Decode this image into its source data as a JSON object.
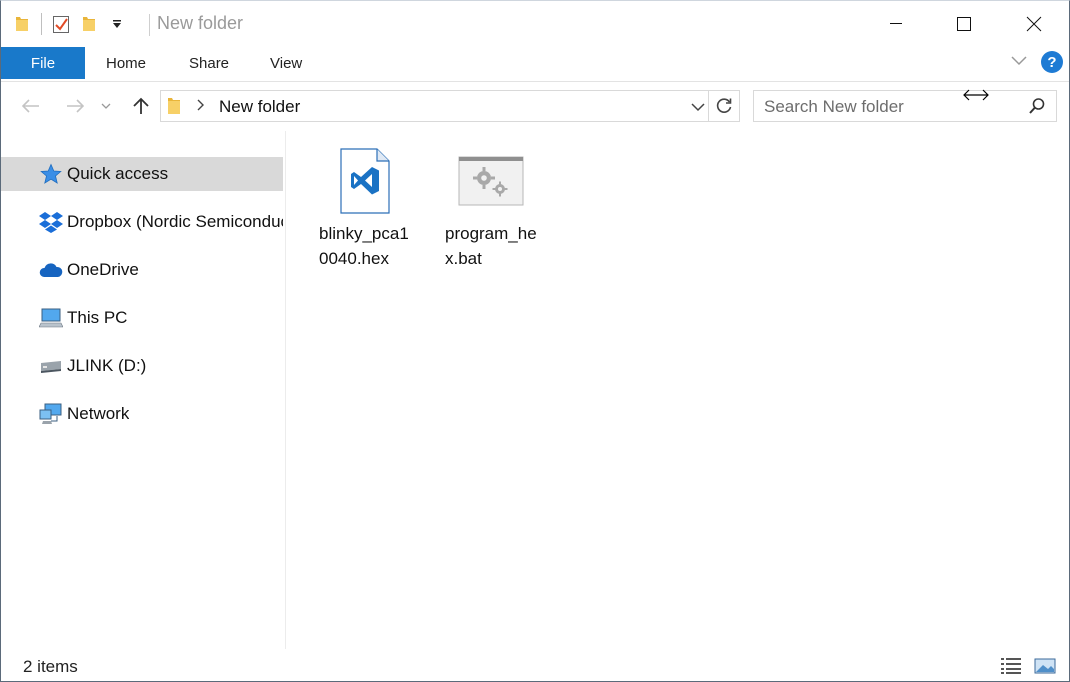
{
  "window": {
    "title": "New folder"
  },
  "ribbon": {
    "tabs": [
      {
        "label": "File"
      },
      {
        "label": "Home"
      },
      {
        "label": "Share"
      },
      {
        "label": "View"
      }
    ]
  },
  "address": {
    "path": "New folder"
  },
  "search": {
    "placeholder": "Search New folder"
  },
  "nav": {
    "items": [
      {
        "label": "Quick access",
        "icon": "star-icon",
        "selected": true
      },
      {
        "label": "Dropbox (Nordic Semiconductor ASA)",
        "icon": "dropbox-icon"
      },
      {
        "label": "OneDrive",
        "icon": "cloud-icon"
      },
      {
        "label": "This PC",
        "icon": "computer-icon"
      },
      {
        "label": "JLINK (D:)",
        "icon": "drive-icon"
      },
      {
        "label": "Network",
        "icon": "network-icon"
      }
    ]
  },
  "files": [
    {
      "name": "blinky_pca10040.hex",
      "icon": "vscode-file-icon"
    },
    {
      "name": "program_hex.bat",
      "icon": "batch-file-icon"
    }
  ],
  "status": {
    "item_count": "2 items"
  },
  "colors": {
    "accent": "#1979ca",
    "selection": "#d9d9d9",
    "folder": "#f0c44c"
  }
}
